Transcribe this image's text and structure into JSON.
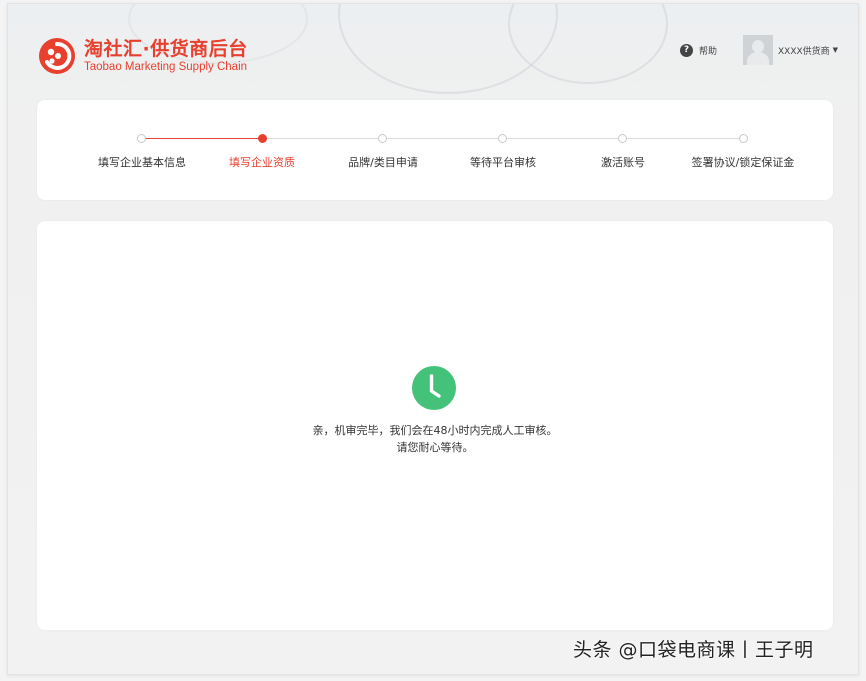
{
  "header": {
    "logo_title": "淘社汇·供货商后台",
    "logo_subtitle": "Taobao Marketing Supply Chain",
    "help_label": "帮助",
    "user_name": "XXXX供货商",
    "brand_color": "#e8402e"
  },
  "steps": {
    "current_index": 1,
    "items": [
      {
        "label": "填写企业基本信息"
      },
      {
        "label": "填写企业资质"
      },
      {
        "label": "品牌/类目申请"
      },
      {
        "label": "等待平台审核"
      },
      {
        "label": "激活账号"
      },
      {
        "label": "签署协议/锁定保证金"
      }
    ]
  },
  "main": {
    "status_icon": "clock-icon",
    "status_color": "#45c27a",
    "message_line1": "亲，机审完毕，我们会在48小时内完成人工审核。",
    "message_line2": "请您耐心等待。"
  },
  "watermark": "头条 @口袋电商课丨王子明"
}
